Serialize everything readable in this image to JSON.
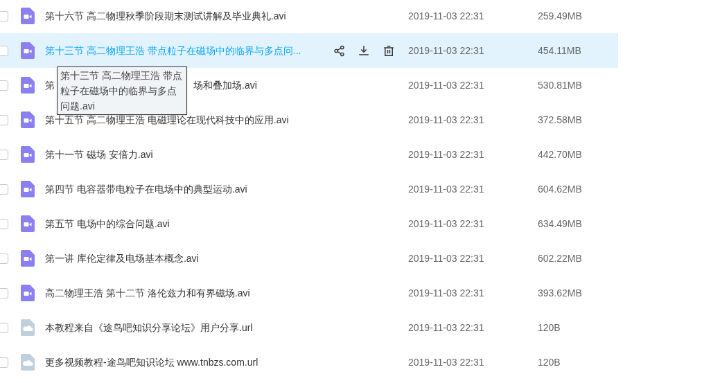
{
  "files": [
    {
      "kind": "video",
      "name": "第十六节 高二物理秋季阶段期末测试讲解及毕业典礼.avi",
      "date": "2019-11-03 22:31",
      "size": "259.49MB",
      "selected": false,
      "checked": false
    },
    {
      "kind": "video",
      "name": "第十三节 高二物理王浩 带点粒子在磁场中的临界与多点问...",
      "date": "2019-11-03 22:31",
      "size": "454.11MB",
      "selected": true,
      "checked": false
    },
    {
      "kind": "video",
      "name_parts": [
        "第",
        "场和叠加场.avi"
      ],
      "date": "2019-11-03 22:31",
      "size": "530.81MB",
      "selected": false,
      "checked": false
    },
    {
      "kind": "video",
      "name": "第十五节 高二物理王浩 电磁理论在现代科技中的应用.avi",
      "date": "2019-11-03 22:31",
      "size": "372.58MB",
      "selected": false,
      "checked": false
    },
    {
      "kind": "video",
      "name": "第十一节 磁场 安倍力.avi",
      "date": "2019-11-03 22:31",
      "size": "442.70MB",
      "selected": false,
      "checked": false
    },
    {
      "kind": "video",
      "name": "第四节 电容器带电粒子在电场中的典型运动.avi",
      "date": "2019-11-03 22:31",
      "size": "604.62MB",
      "selected": false,
      "checked": false
    },
    {
      "kind": "video",
      "name": "第五节 电场中的综合问题.avi",
      "date": "2019-11-03 22:31",
      "size": "634.49MB",
      "selected": false,
      "checked": false
    },
    {
      "kind": "video",
      "name": "第一讲 库伦定律及电场基本概念.avi",
      "date": "2019-11-03 22:31",
      "size": "602.22MB",
      "selected": false,
      "checked": false
    },
    {
      "kind": "video",
      "name": "高二物理王浩 第十二节 洛伦兹力和有界磁场.avi",
      "date": "2019-11-03 22:31",
      "size": "393.62MB",
      "selected": false,
      "checked": false
    },
    {
      "kind": "link",
      "name": "本教程来自《途鸟吧知识分享论坛》用户分享.url",
      "date": "2019-11-03 22:31",
      "size": "120B",
      "selected": false,
      "checked": false
    },
    {
      "kind": "link",
      "name": "更多视频教程-途鸟吧知识论坛 www.tnbzs.com.url",
      "date": "2019-11-03 22:31",
      "size": "120B",
      "selected": false,
      "checked": false
    }
  ],
  "tooltip": {
    "text": "第十三节 高二物理王浩 带点粒子在磁场中的临界与多点问题.avi"
  }
}
